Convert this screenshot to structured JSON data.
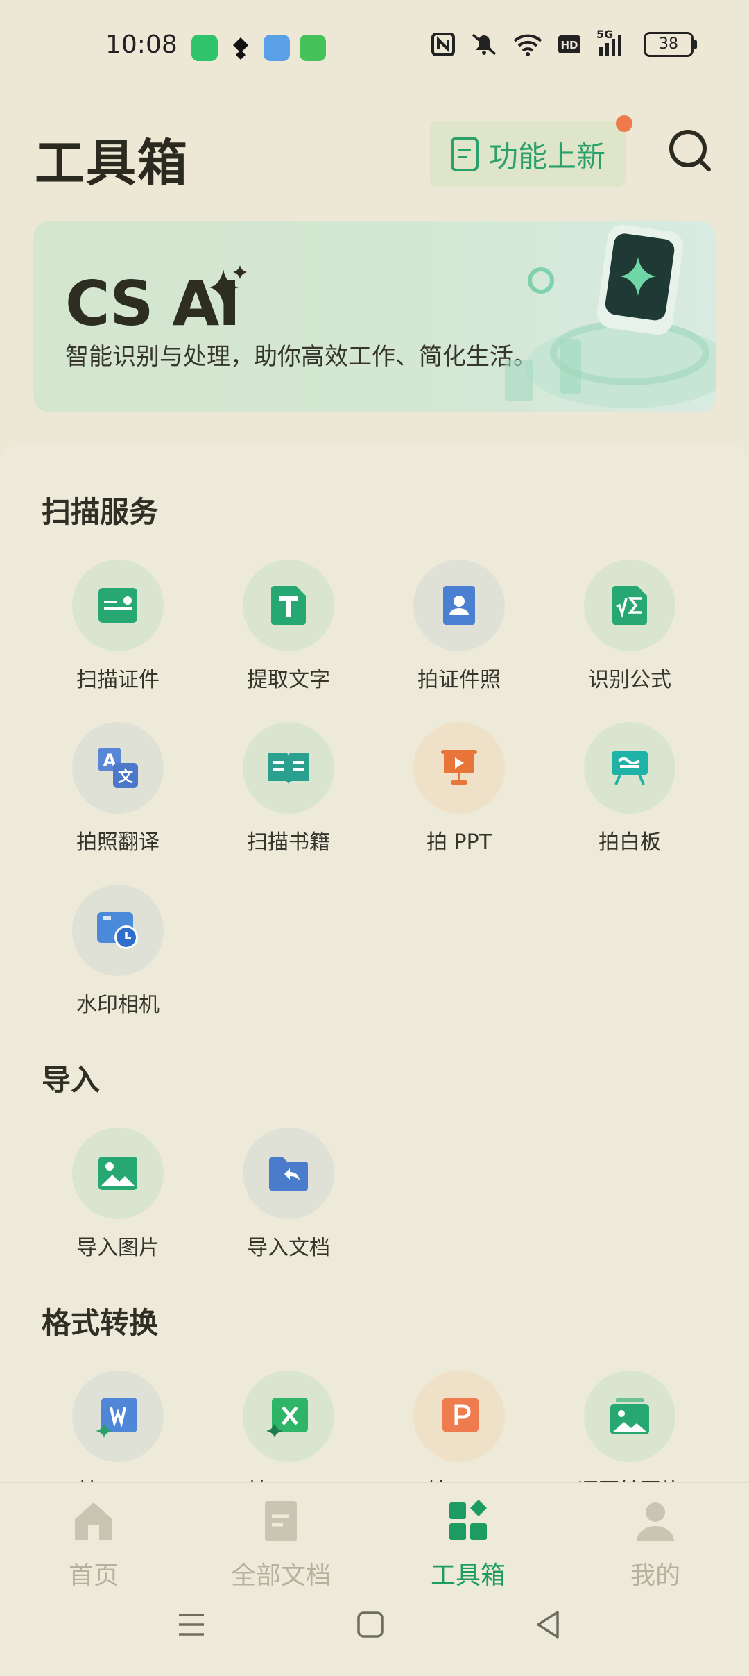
{
  "status_bar": {
    "time": "10:08",
    "network": "5G",
    "battery": "38",
    "icons": [
      "nfc-icon",
      "mute-icon",
      "wifi-icon",
      "hd-icon",
      "signal-icon",
      "battery-icon"
    ]
  },
  "header": {
    "title": "工具箱",
    "whats_new_label": "功能上新",
    "accent": "#2aa06a"
  },
  "banner": {
    "title": "CS AI",
    "subtitle": "智能识别与处理，助你高效工作、简化生活。"
  },
  "sections": {
    "scan": {
      "title": "扫描服务",
      "items": [
        {
          "label": "扫描证件",
          "icon": "id-card-icon"
        },
        {
          "label": "提取文字",
          "icon": "text-extract-icon"
        },
        {
          "label": "拍证件照",
          "icon": "id-photo-icon"
        },
        {
          "label": "识别公式",
          "icon": "formula-icon"
        },
        {
          "label": "拍照翻译",
          "icon": "translate-icon"
        },
        {
          "label": "扫描书籍",
          "icon": "book-icon"
        },
        {
          "label": "拍 PPT",
          "icon": "ppt-capture-icon"
        },
        {
          "label": "拍白板",
          "icon": "whiteboard-icon"
        },
        {
          "label": "水印相机",
          "icon": "watermark-camera-icon"
        }
      ]
    },
    "import": {
      "title": "导入",
      "items": [
        {
          "label": "导入图片",
          "icon": "image-import-icon"
        },
        {
          "label": "导入文档",
          "icon": "document-import-icon"
        }
      ]
    },
    "convert": {
      "title": "格式转换",
      "items": [
        {
          "label": "转 Word",
          "icon": "word-icon"
        },
        {
          "label": "转 Excel",
          "icon": "excel-icon"
        },
        {
          "label": "转 PPT",
          "icon": "ppt-icon"
        },
        {
          "label": "逐页转图片",
          "icon": "to-image-icon"
        }
      ]
    }
  },
  "bottom_nav": {
    "items": [
      {
        "label": "首页",
        "icon": "home-icon"
      },
      {
        "label": "全部文档",
        "icon": "documents-icon"
      },
      {
        "label": "工具箱",
        "icon": "toolbox-icon",
        "active": true
      },
      {
        "label": "我的",
        "icon": "profile-icon"
      }
    ]
  }
}
